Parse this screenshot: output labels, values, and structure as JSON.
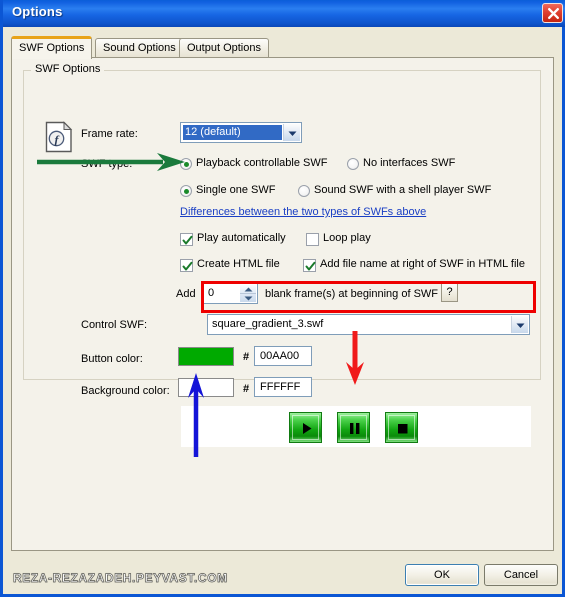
{
  "window": {
    "title": "Options",
    "close_icon": "close-icon"
  },
  "tabs": [
    {
      "label": "SWF Options",
      "active": true
    },
    {
      "label": "Sound Options",
      "active": false
    },
    {
      "label": "Output Options",
      "active": false
    }
  ],
  "group": {
    "title": "SWF Options",
    "icon": "flash-swf-file-icon"
  },
  "frame_rate": {
    "label": "Frame rate:",
    "value": "12 (default)",
    "dropdown_icon": "chevron-down-icon"
  },
  "swf_type": {
    "label": "SWF type:",
    "options": [
      {
        "label": "Playback controllable SWF",
        "selected": true
      },
      {
        "label": "No interfaces SWF",
        "selected": false
      },
      {
        "label": "Single one SWF",
        "selected": true
      },
      {
        "label": "Sound SWF with a shell player SWF",
        "selected": false
      }
    ],
    "link": "Differences between the two types of SWFs above"
  },
  "checkboxes": [
    {
      "label": "Play automatically",
      "checked": true
    },
    {
      "label": "Loop play",
      "checked": false
    },
    {
      "label": "Create HTML file",
      "checked": true
    },
    {
      "label": "Add file name at right of SWF in HTML file",
      "checked": true
    }
  ],
  "blank_frames": {
    "prefix": "Add",
    "value": "0",
    "suffix": "blank frame(s) at beginning of SWF",
    "help_label": "?",
    "spinner_icon": "spinner-up-down-icon"
  },
  "control_swf": {
    "label": "Control SWF:",
    "value": "square_gradient_3.swf",
    "dropdown_icon": "chevron-down-icon"
  },
  "button_color": {
    "label": "Button color:",
    "hash": "#",
    "hex": "00AA00",
    "swatch": "#00AA00"
  },
  "background_color": {
    "label": "Background color:",
    "hash": "#",
    "hex": "FFFFFF",
    "swatch": "#FFFFFF"
  },
  "preview": {
    "buttons": [
      {
        "icon": "play-icon"
      },
      {
        "icon": "pause-icon"
      },
      {
        "icon": "stop-icon"
      }
    ]
  },
  "footer": {
    "ok_label": "OK",
    "cancel_label": "Cancel",
    "watermark": "REZA-REZAZADEH.PEYVAST.COM"
  },
  "annotations": {
    "green_arrow": "green-arrow-right",
    "red_arrow": "red-arrow-down",
    "blue_arrow": "blue-arrow-up",
    "red_box": "red-highlight-box"
  },
  "colors": {
    "titlebar": "#1766E4",
    "accent_tab": "#E8A317",
    "face": "#ECE9D8",
    "green": "#00AA00",
    "red_anno": "#EE0000",
    "blue_anno": "#0000CC",
    "green_anno": "#1A7A3C"
  }
}
